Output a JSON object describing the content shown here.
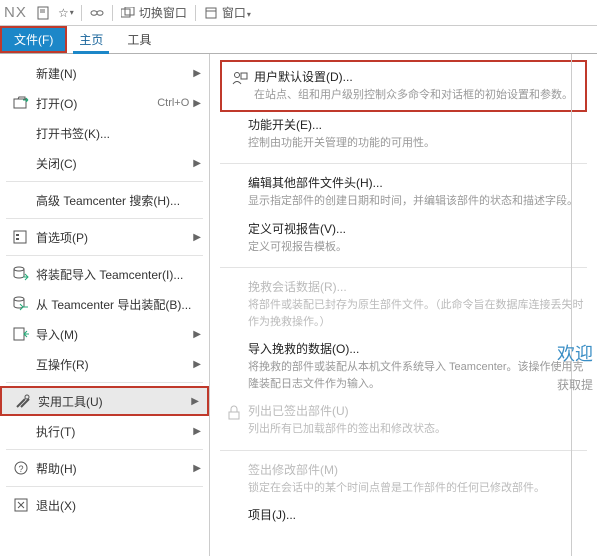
{
  "app": {
    "name": "NX"
  },
  "titlebar": {
    "switch_windows": "切换窗口",
    "window": "窗口"
  },
  "menubar": {
    "file": "文件(F)",
    "home": "主页",
    "tools": "工具"
  },
  "filemenu": {
    "new": "新建(N)",
    "open": "打开(O)",
    "open_shortcut": "Ctrl+O",
    "open_bookmark": "打开书签(K)...",
    "close": "关闭(C)",
    "adv_tc_search": "高级 Teamcenter 搜索(H)...",
    "preferences": "首选项(P)",
    "import_asm_tc": "将装配导入 Teamcenter(I)...",
    "export_asm_tc": "从 Teamcenter 导出装配(B)...",
    "import": "导入(M)",
    "interop": "互操作(R)",
    "utilities": "实用工具(U)",
    "execute": "执行(T)",
    "help": "帮助(H)",
    "exit": "退出(X)"
  },
  "submenu": {
    "user_defaults": {
      "title": "用户默认设置(D)...",
      "desc": "在站点、组和用户级别控制众多命令和对话框的初始设置和参数。"
    },
    "feature_switch": {
      "title": "功能开关(E)...",
      "desc": "控制由功能开关管理的功能的可用性。"
    },
    "edit_other_header": {
      "title": "编辑其他部件文件头(H)...",
      "desc": "显示指定部件的创建日期和时间，并编辑该部件的状态和描述字段。"
    },
    "custom_report": {
      "title": "定义可视报告(V)...",
      "desc": "定义可视报告模板。"
    },
    "rescue_session": {
      "title": "挽救会话数据(R)...",
      "desc": "将部件或装配已封存为原生部件文件。（此命令旨在数据库连接丢失时作为挽救操作。）"
    },
    "import_rescued": {
      "title": "导入挽救的数据(O)...",
      "desc": "将挽救的部件或装配从本机文件系统导入 Teamcenter。该操作使用克隆装配日志文件作为输入。"
    },
    "list_checked_out": {
      "title": "列出已签出部件(U)",
      "desc": "列出所有已加载部件的签出和修改状态。"
    },
    "checkout_modified": {
      "title": "签出修改部件(M)",
      "desc": "锁定在会话中的某个时间点曾是工作部件的任何已修改部件。"
    },
    "project": {
      "title": "项目(J)...",
      "desc": ""
    }
  },
  "right_peek": {
    "welcome": "欢迎",
    "getstarted": "获取提"
  }
}
